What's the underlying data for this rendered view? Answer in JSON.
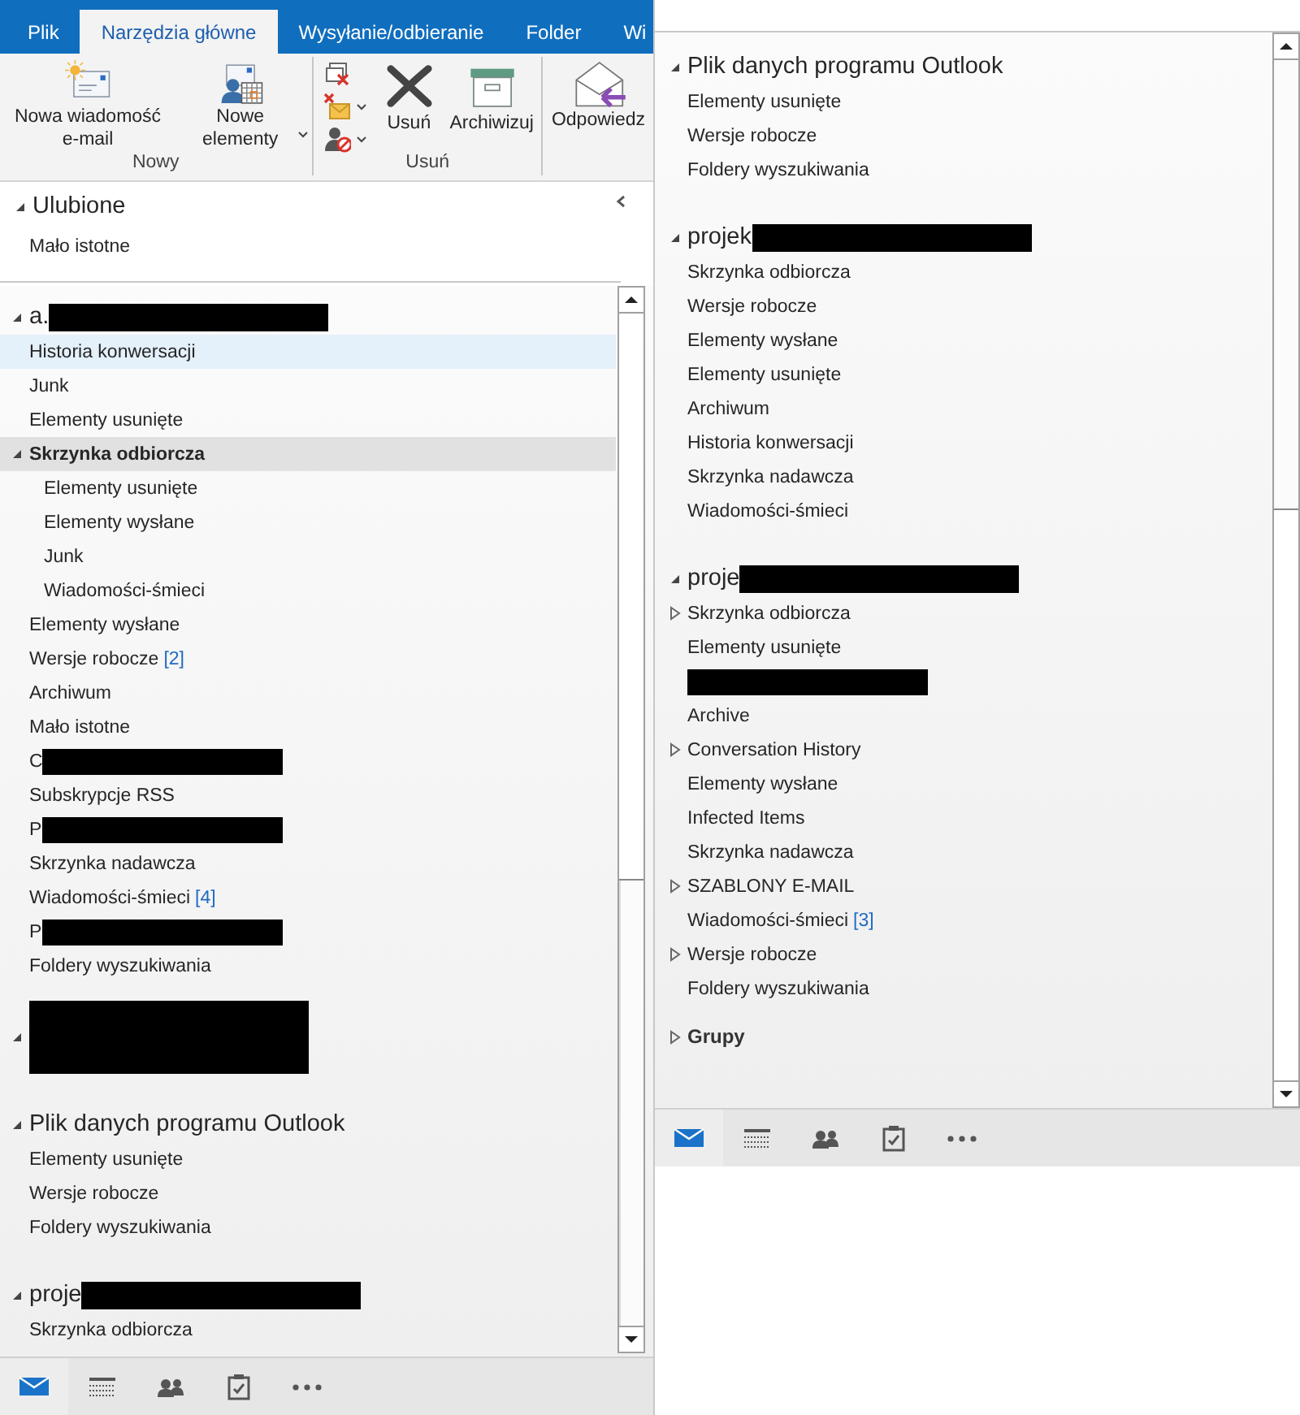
{
  "left_pane": {
    "menu_tabs": [
      {
        "label": "Plik",
        "selected": false
      },
      {
        "label": "Narzędzia główne",
        "selected": true
      },
      {
        "label": "Wysyłanie/odbieranie",
        "selected": false
      },
      {
        "label": "Folder",
        "selected": false
      },
      {
        "label": "Wi",
        "selected": false
      }
    ],
    "ribbon_groups": [
      {
        "label": "Nowy",
        "buttons": [
          {
            "kind": "large",
            "label": "Nowa wiadomość e-mail",
            "dropdown": false
          },
          {
            "kind": "large",
            "label": "Nowe elementy",
            "dropdown": true
          }
        ]
      },
      {
        "label": "Usuń",
        "buttons": [
          {
            "kind": "small",
            "dropdown": false
          },
          {
            "kind": "small",
            "dropdown": true
          },
          {
            "kind": "small",
            "dropdown": true
          },
          {
            "kind": "large",
            "label": "Usuń",
            "dropdown": false
          },
          {
            "kind": "large",
            "label": "Archiwizuj",
            "dropdown": false
          }
        ]
      },
      {
        "buttons": [
          {
            "kind": "large",
            "label": "Odpowiedz",
            "dropdown": false
          }
        ]
      }
    ],
    "favorites": {
      "title": "Ulubione",
      "expanded": true,
      "items": [
        {
          "label": "Mało istotne"
        }
      ]
    },
    "accounts": [
      {
        "kind": "account",
        "name": "a.",
        "redacted": true,
        "expanded": true,
        "folders": [
          {
            "label": "Historia konwersacji",
            "selected": false,
            "hovered": true
          },
          {
            "label": "Junk",
            "selected": false,
            "hovered": false
          },
          {
            "label": "Elementy usunięte",
            "selected": false,
            "hovered": false
          },
          {
            "label": "Skrzynka odbiorcza",
            "selected": true,
            "hovered": false,
            "expanded": true,
            "children": [
              {
                "label": "Elementy usunięte",
                "selected": false,
                "hovered": false
              },
              {
                "label": "Elementy wysłane",
                "selected": false,
                "hovered": false
              },
              {
                "label": "Junk",
                "selected": false,
                "hovered": false
              },
              {
                "label": "Wiadomości-śmieci",
                "selected": false,
                "hovered": false
              }
            ]
          },
          {
            "label": "Elementy wysłane",
            "selected": false,
            "hovered": false
          },
          {
            "label": "Wersje robocze",
            "count": "[2]",
            "selected": false,
            "hovered": false
          },
          {
            "label": "Archiwum",
            "selected": false,
            "hovered": false
          },
          {
            "label": "Mało istotne",
            "selected": false,
            "hovered": false
          },
          {
            "label": "C",
            "redacted": true,
            "selected": false,
            "hovered": false
          },
          {
            "label": "Subskrypcje RSS",
            "selected": false,
            "hovered": false
          },
          {
            "label": "P",
            "redacted": true,
            "selected": false,
            "hovered": false
          },
          {
            "label": "Skrzynka nadawcza",
            "selected": false,
            "hovered": false
          },
          {
            "label": "Wiadomości-śmieci",
            "count": "[4]",
            "selected": false,
            "hovered": false
          },
          {
            "label": "P",
            "redacted": true,
            "selected": false,
            "hovered": false
          },
          {
            "label": "Foldery wyszukiwania",
            "selected": false,
            "hovered": false
          }
        ]
      },
      {
        "kind": "hidden-account",
        "redacted": true,
        "expanded": true
      },
      {
        "kind": "account",
        "name": "Plik danych programu Outlook",
        "expanded": true,
        "folders": [
          {
            "label": "Elementy usunięte",
            "selected": false,
            "hovered": false
          },
          {
            "label": "Wersje robocze",
            "selected": false,
            "hovered": false
          },
          {
            "label": "Foldery wyszukiwania",
            "selected": false,
            "hovered": false
          }
        ]
      },
      {
        "kind": "account",
        "name": "proje",
        "redacted": true,
        "expanded": true,
        "folders": [
          {
            "label": "Skrzynka odbiorcza",
            "selected": false,
            "hovered": false
          }
        ]
      }
    ],
    "nav": [
      {
        "selected": true
      },
      {
        "selected": false
      },
      {
        "selected": false
      },
      {
        "selected": false
      },
      {
        "selected": false
      }
    ]
  },
  "right_pane": {
    "accounts": [
      {
        "kind": "account",
        "name": "Plik danych programu Outlook",
        "expanded": true,
        "folders": [
          {
            "label": "Elementy usunięte",
            "selected": false,
            "hovered": false
          },
          {
            "label": "Wersje robocze",
            "selected": false,
            "hovered": false
          },
          {
            "label": "Foldery wyszukiwania",
            "selected": false,
            "hovered": false
          }
        ]
      },
      {
        "kind": "account",
        "name": "projek",
        "redacted": true,
        "expanded": true,
        "folders": [
          {
            "label": "Skrzynka odbiorcza",
            "selected": false,
            "hovered": false
          },
          {
            "label": "Wersje robocze",
            "selected": false,
            "hovered": false
          },
          {
            "label": "Elementy wysłane",
            "selected": false,
            "hovered": false
          },
          {
            "label": "Elementy usunięte",
            "selected": false,
            "hovered": false
          },
          {
            "label": "Archiwum",
            "selected": false,
            "hovered": false
          },
          {
            "label": "Historia konwersacji",
            "selected": false,
            "hovered": false
          },
          {
            "label": "Skrzynka nadawcza",
            "selected": false,
            "hovered": false
          },
          {
            "label": "Wiadomości-śmieci",
            "selected": false,
            "hovered": false
          }
        ]
      },
      {
        "kind": "account",
        "name": "proje",
        "redacted": true,
        "expanded": true,
        "folders": [
          {
            "label": "Skrzynka odbiorcza",
            "selected": false,
            "hovered": false,
            "expanded": false
          },
          {
            "label": "Elementy usunięte",
            "selected": false,
            "hovered": false
          },
          {
            "redacted": true,
            "selected": false,
            "hovered": false
          },
          {
            "label": "Archive",
            "selected": false,
            "hovered": false
          },
          {
            "label": "Conversation History",
            "selected": false,
            "hovered": false,
            "expanded": false
          },
          {
            "label": "Elementy wysłane",
            "selected": false,
            "hovered": false
          },
          {
            "label": "Infected Items",
            "selected": false,
            "hovered": false
          },
          {
            "label": "Skrzynka nadawcza",
            "selected": false,
            "hovered": false
          },
          {
            "label": "SZABLONY E-MAIL",
            "selected": false,
            "hovered": false,
            "expanded": false
          },
          {
            "label": "Wiadomości-śmieci",
            "count": "[3]",
            "selected": false,
            "hovered": false
          },
          {
            "label": "Wersje robocze",
            "selected": false,
            "hovered": false,
            "expanded": false
          },
          {
            "label": "Foldery wyszukiwania",
            "selected": false,
            "hovered": false
          }
        ]
      },
      {
        "kind": "group",
        "name": "Grupy",
        "expanded": false
      }
    ],
    "nav": [
      {
        "selected": true
      },
      {
        "selected": false
      },
      {
        "selected": false
      },
      {
        "selected": false
      },
      {
        "selected": false
      }
    ]
  }
}
